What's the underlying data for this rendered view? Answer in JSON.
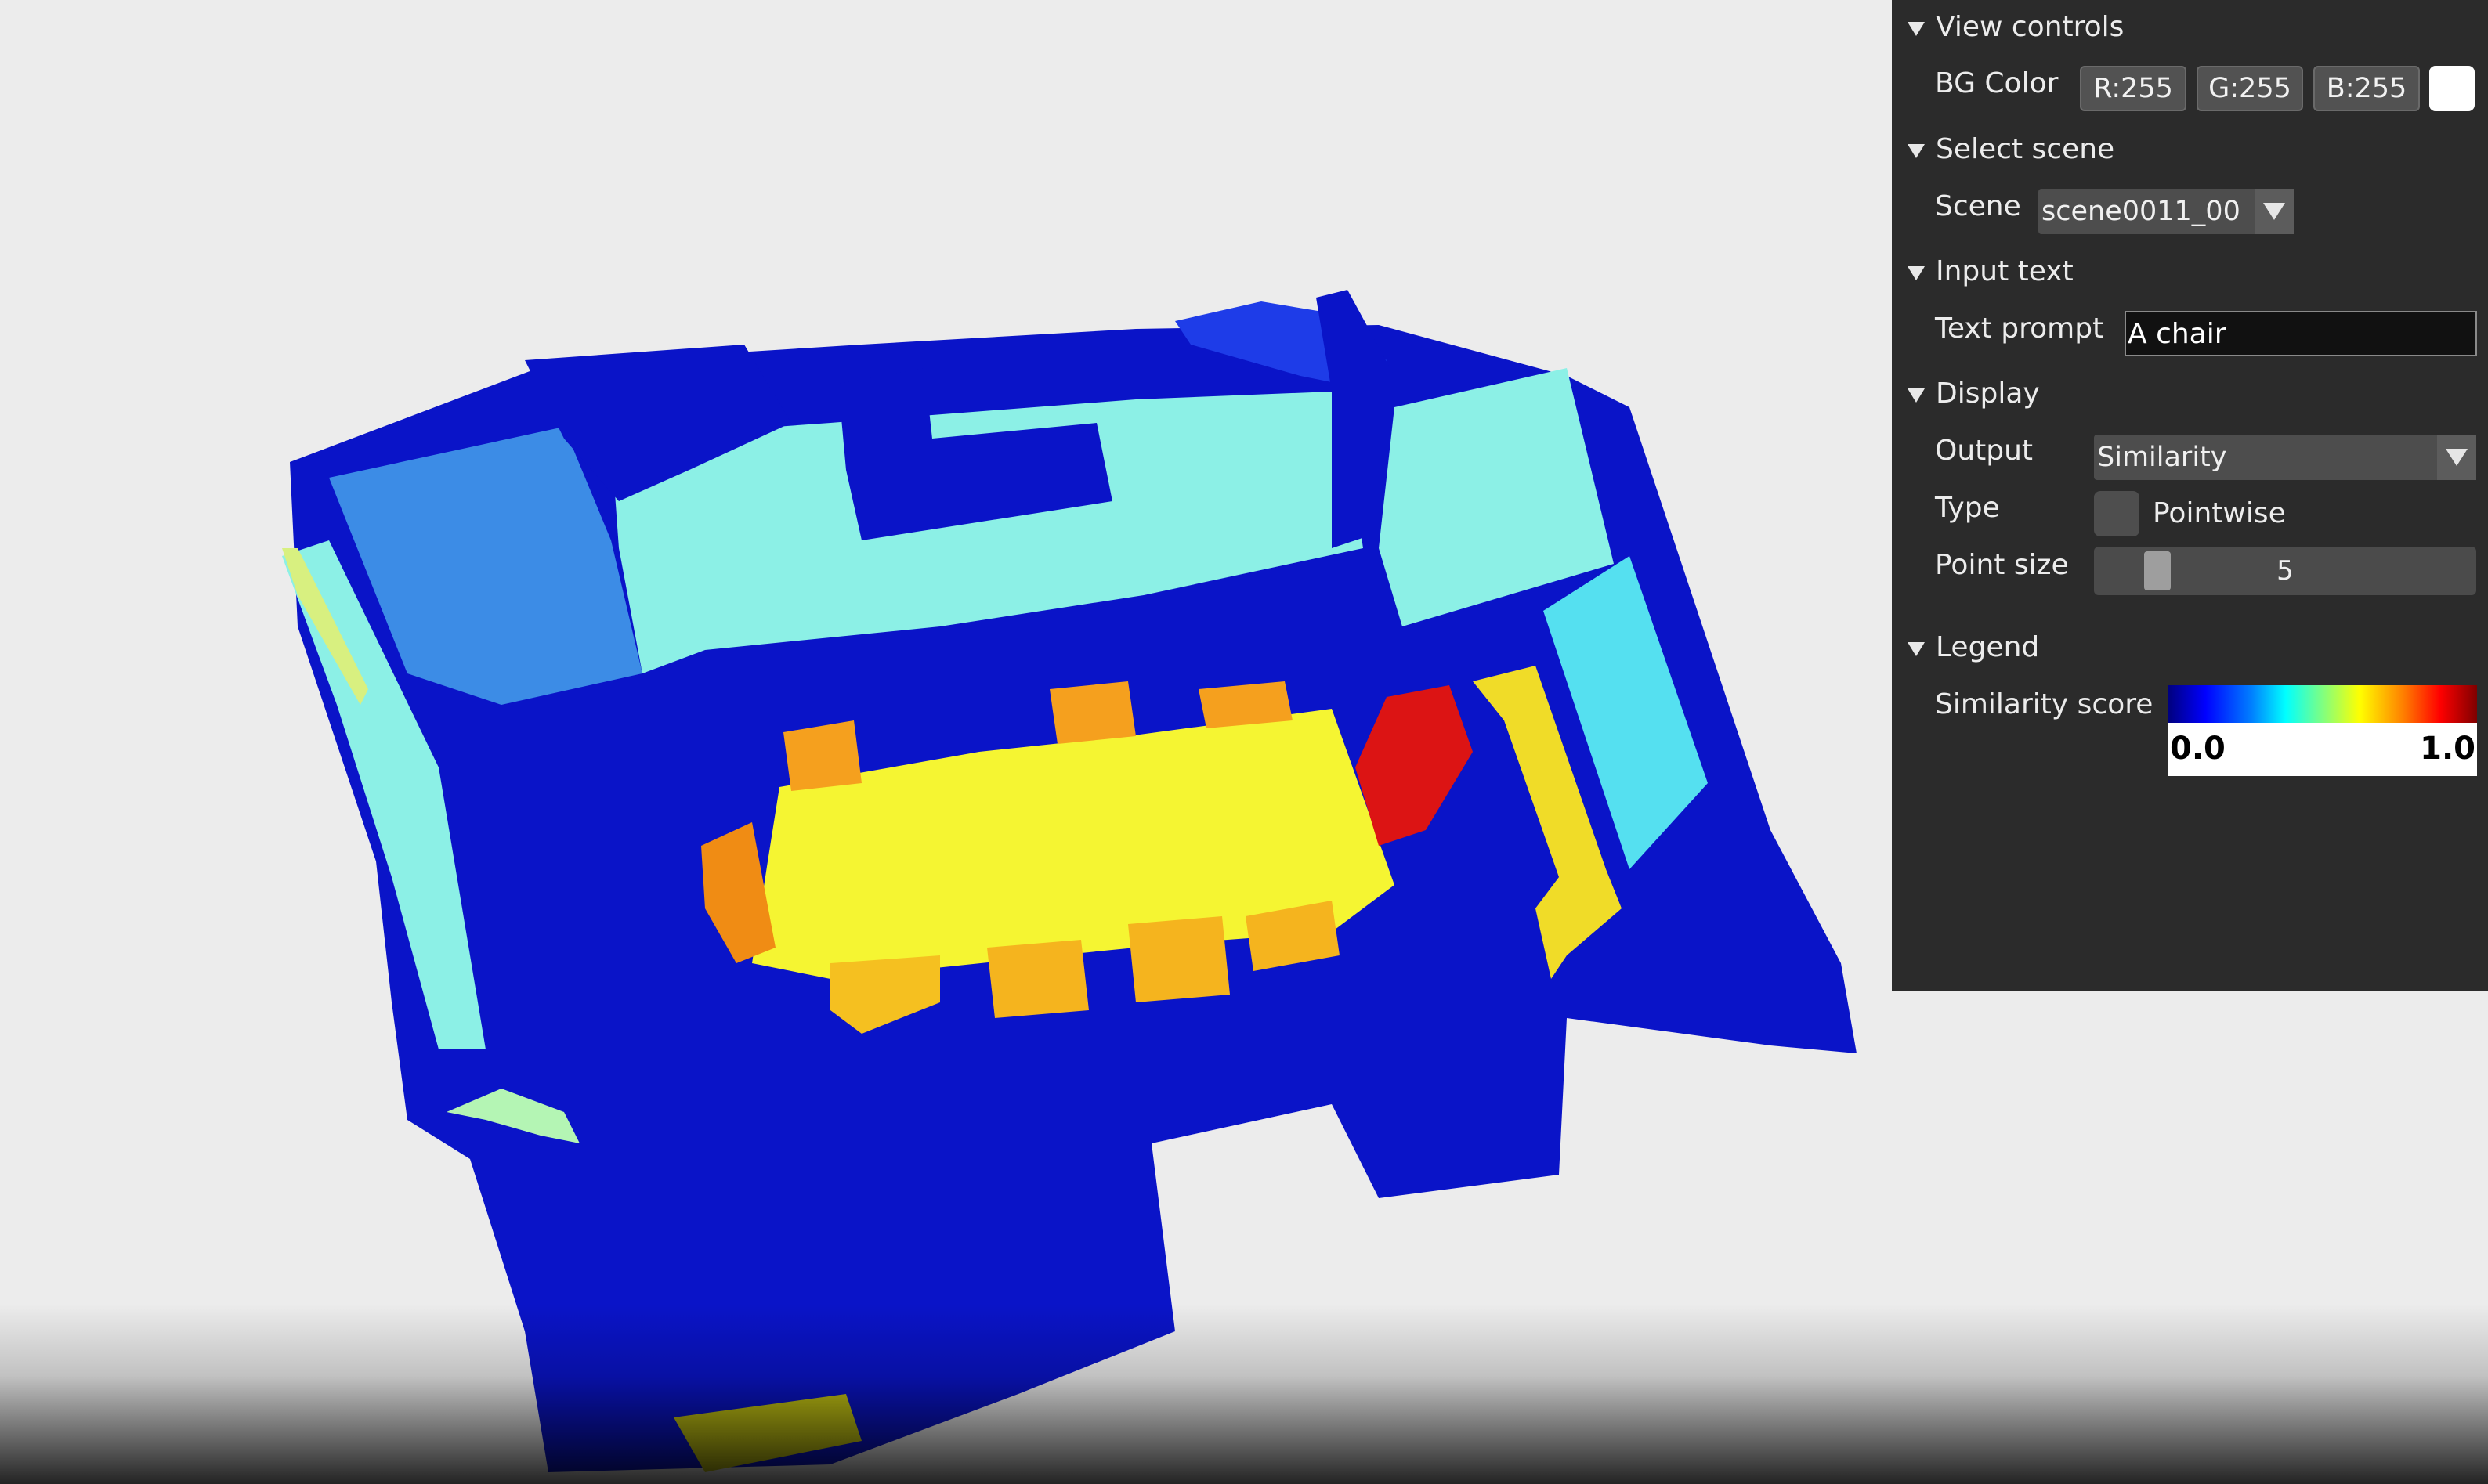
{
  "panel": {
    "view_controls": {
      "header": "View controls",
      "bg_color_label": "BG Color",
      "r_button": "R:255",
      "g_button": "G:255",
      "b_button": "B:255",
      "bg_color_value": "#ffffff"
    },
    "select_scene": {
      "header": "Select scene",
      "scene_label": "Scene",
      "scene_value": "scene0011_00"
    },
    "input_text": {
      "header": "Input text",
      "prompt_label": "Text prompt",
      "prompt_value": "A chair"
    },
    "display": {
      "header": "Display",
      "output_label": "Output",
      "output_value": "Similarity",
      "type_label": "Type",
      "type_checkbox_label": "Pointwise",
      "type_checked": false,
      "point_size_label": "Point size",
      "point_size_value": "5"
    },
    "legend": {
      "header": "Legend",
      "title": "Similarity score",
      "min_label": "0.0",
      "max_label": "1.0",
      "colormap": [
        "#00007f",
        "#0000ff",
        "#0080ff",
        "#00ffff",
        "#80ff80",
        "#ffff00",
        "#ff8000",
        "#ff0000",
        "#7f0000"
      ]
    }
  },
  "viewport": {
    "background": "#ececec",
    "point_cloud_colors": {
      "low": "#0a14c8",
      "light_blue": "#3c8ce6",
      "cyan": "#8cf0e6",
      "yellow": "#f5f532",
      "orange": "#f5a01e",
      "red": "#dc1414"
    }
  }
}
